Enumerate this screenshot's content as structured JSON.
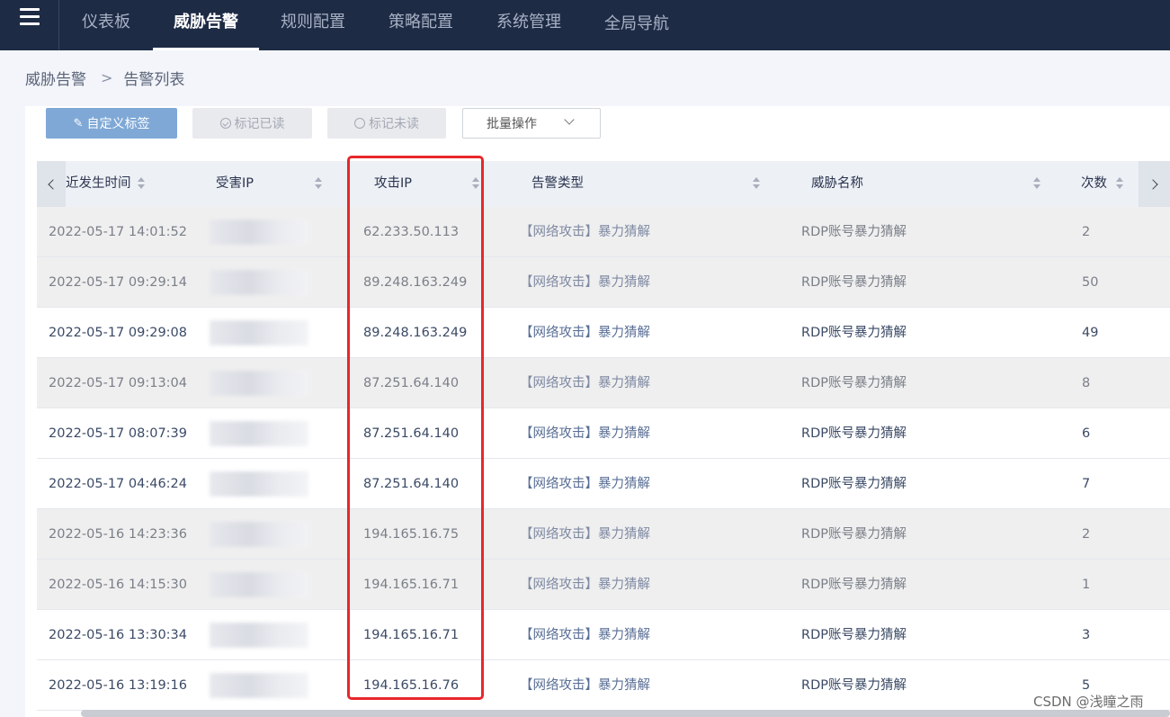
{
  "nav": {
    "tabs": [
      "仪表板",
      "威胁告警",
      "规则配置",
      "策略配置",
      "系统管理",
      "全局导航"
    ],
    "active_index": 1
  },
  "breadcrumb": {
    "parent": "威胁告警",
    "current": "告警列表"
  },
  "toolbar": {
    "custom_tag": "自定义标签",
    "mark_read": "标记已读",
    "mark_unread": "标记未读",
    "batch_ops": "批量操作"
  },
  "table": {
    "columns": [
      "近发生时间",
      "受害IP",
      "攻击IP",
      "告警类型",
      "威胁名称",
      "次数"
    ],
    "rows": [
      {
        "time": "2022-05-17 14:01:52",
        "attack_ip": "62.233.50.113",
        "type": "【网络攻击】暴力猜解",
        "threat": "RDP账号暴力猜解",
        "count": "2",
        "read": true
      },
      {
        "time": "2022-05-17 09:29:14",
        "attack_ip": "89.248.163.249",
        "type": "【网络攻击】暴力猜解",
        "threat": "RDP账号暴力猜解",
        "count": "50",
        "read": true
      },
      {
        "time": "2022-05-17 09:29:08",
        "attack_ip": "89.248.163.249",
        "type": "【网络攻击】暴力猜解",
        "threat": "RDP账号暴力猜解",
        "count": "49",
        "read": false
      },
      {
        "time": "2022-05-17 09:13:04",
        "attack_ip": "87.251.64.140",
        "type": "【网络攻击】暴力猜解",
        "threat": "RDP账号暴力猜解",
        "count": "8",
        "read": true
      },
      {
        "time": "2022-05-17 08:07:39",
        "attack_ip": "87.251.64.140",
        "type": "【网络攻击】暴力猜解",
        "threat": "RDP账号暴力猜解",
        "count": "6",
        "read": false
      },
      {
        "time": "2022-05-17 04:46:24",
        "attack_ip": "87.251.64.140",
        "type": "【网络攻击】暴力猜解",
        "threat": "RDP账号暴力猜解",
        "count": "7",
        "read": false
      },
      {
        "time": "2022-05-16 14:23:36",
        "attack_ip": "194.165.16.75",
        "type": "【网络攻击】暴力猜解",
        "threat": "RDP账号暴力猜解",
        "count": "2",
        "read": true
      },
      {
        "time": "2022-05-16 14:15:30",
        "attack_ip": "194.165.16.71",
        "type": "【网络攻击】暴力猜解",
        "threat": "RDP账号暴力猜解",
        "count": "1",
        "read": true
      },
      {
        "time": "2022-05-16 13:30:34",
        "attack_ip": "194.165.16.71",
        "type": "【网络攻击】暴力猜解",
        "threat": "RDP账号暴力猜解",
        "count": "3",
        "read": false
      },
      {
        "time": "2022-05-16 13:19:16",
        "attack_ip": "194.165.16.76",
        "type": "【网络攻击】暴力猜解",
        "threat": "RDP账号暴力猜解",
        "count": "5",
        "read": false
      }
    ]
  },
  "watermark": "CSDN @浅瞳之雨",
  "colors": {
    "nav_bg": "#1e2b45",
    "highlight": "#e8272b",
    "primary_btn": "#7fa8d6"
  }
}
